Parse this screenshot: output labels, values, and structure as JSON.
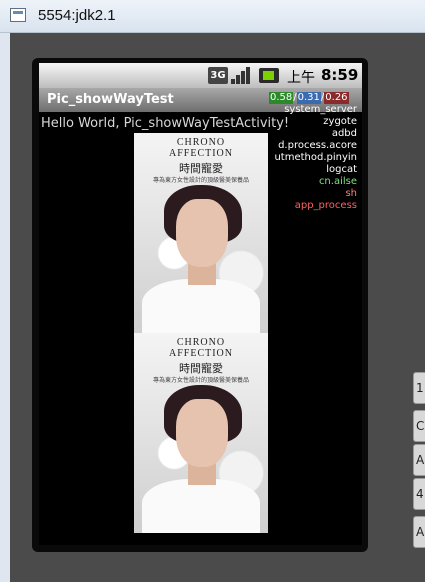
{
  "window": {
    "title": "5554:jdk2.1"
  },
  "status_bar": {
    "network": "3G",
    "ampm": "上午",
    "time": "8:59"
  },
  "app": {
    "title": "Pic_showWayTest",
    "hello_text": "Hello World, Pic_showWayTestActivity!"
  },
  "load_avg": {
    "l1": "0.58",
    "l2": "0.31",
    "l3": "0.26",
    "separator": " / "
  },
  "processes": [
    {
      "name": "system_server",
      "color": "#ffffff"
    },
    {
      "name": "zygote",
      "color": "#ffffff"
    },
    {
      "name": "adbd",
      "color": "#ffffff"
    },
    {
      "name": "d.process.acore",
      "color": "#ffffff"
    },
    {
      "name": "utmethod.pinyin",
      "color": "#ffffff"
    },
    {
      "name": "logcat",
      "color": "#ffffff"
    },
    {
      "name": "cn.ailse",
      "color": "#7fe07f"
    },
    {
      "name": "sh",
      "color": "#ff8080"
    },
    {
      "name": "app_process",
      "color": "#ff6060"
    }
  ],
  "image_ad": {
    "brand_line1": "CHRONO",
    "brand_line2": "AFFECTION",
    "brand_cn": "時間寵愛",
    "tagline": "專為東方女性設計的頂級醫美保養品"
  },
  "side_controls": [
    "1",
    "C",
    "A",
    "4",
    "A"
  ]
}
